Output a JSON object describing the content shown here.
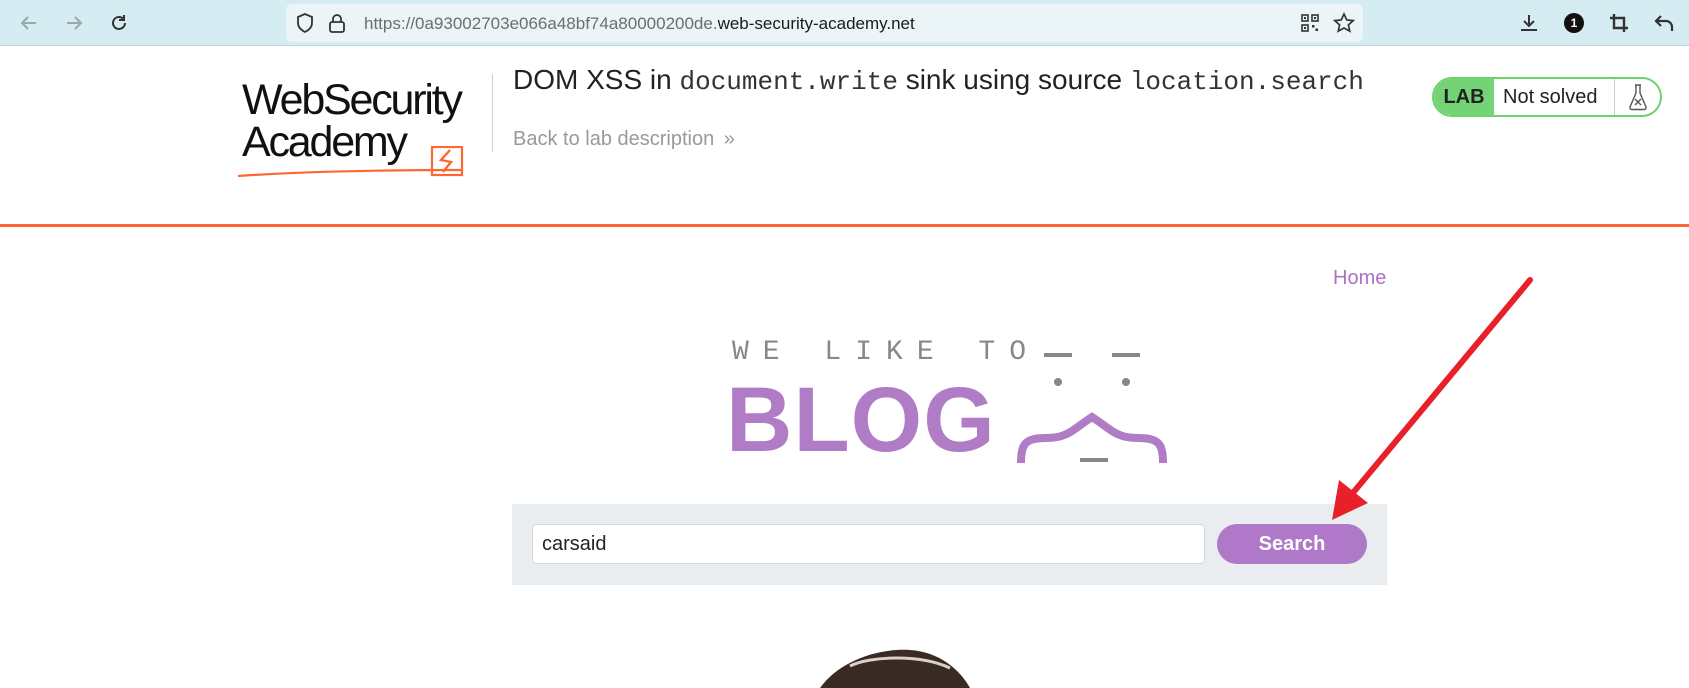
{
  "browser": {
    "url_prefix": "https://0a93002703e066a48bf74a80000200de.",
    "url_domain": "web-security-academy.net",
    "extension_badge": "1"
  },
  "academy": {
    "logo_line1": "WebSecurity",
    "logo_line2": "Academy",
    "title_part1": "DOM XSS in ",
    "title_code1": "document.write",
    "title_part2": " sink using source ",
    "title_code2": "location.search",
    "back_link": "Back to lab description",
    "back_chevrons": "»",
    "lab_label": "LAB",
    "lab_status": "Not solved"
  },
  "blog": {
    "home_link": "Home",
    "logo_tagline": "WE LIKE TO",
    "logo_word": "BLOG",
    "search": {
      "value": "carsaid",
      "button_label": "Search"
    }
  },
  "colors": {
    "accent_orange": "#ff6633",
    "blog_purple": "#b07cc6",
    "lab_green": "#74d374",
    "annotation_red": "#e8202a"
  }
}
